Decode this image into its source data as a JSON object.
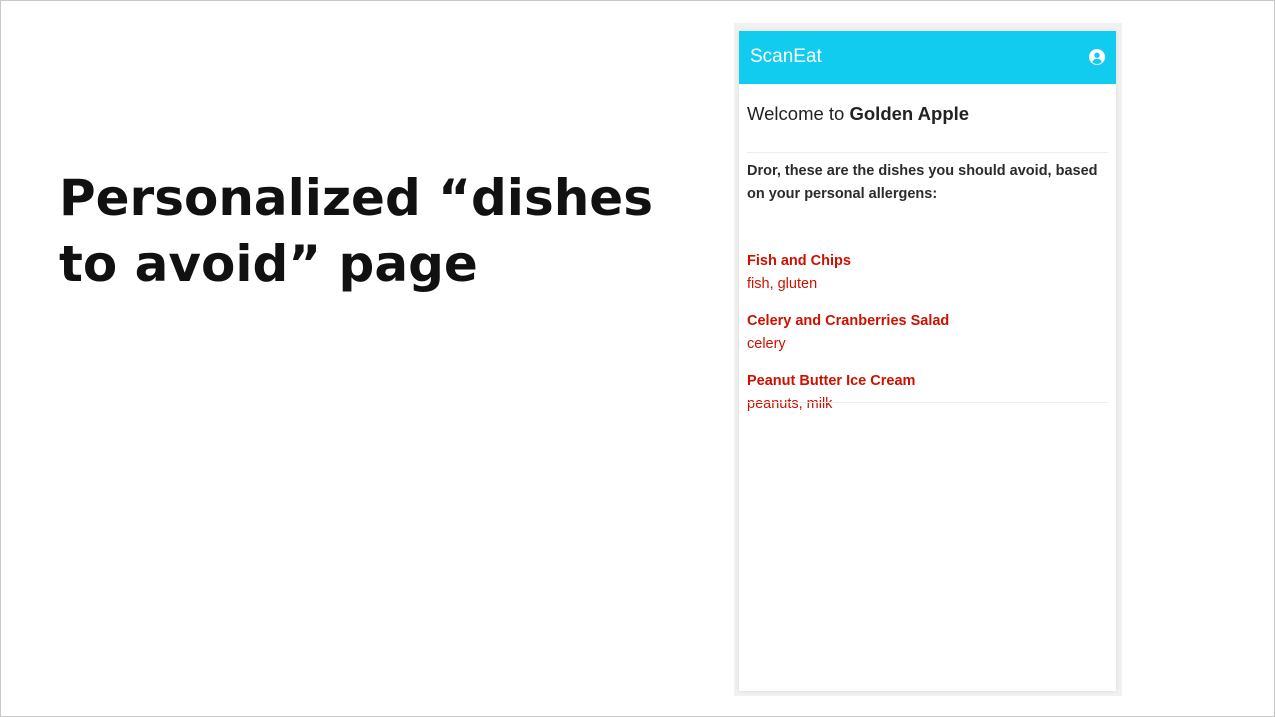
{
  "slide": {
    "title": "Personalized “dishes to avoid” page"
  },
  "app": {
    "name": "ScanEat",
    "account_icon": "user-circle-icon",
    "colors": {
      "app_bar": "#12ccf0",
      "warning_text": "#cc1100"
    },
    "welcome_prefix": "Welcome to ",
    "restaurant_name": "Golden Apple",
    "intro": "Dror, these are the dishes you should avoid, based on your personal allergens:",
    "dishes": [
      {
        "name": "Fish and Chips",
        "allergens": "fish, gluten"
      },
      {
        "name": "Celery and Cranberries Salad",
        "allergens": "celery"
      },
      {
        "name": "Peanut Butter Ice Cream",
        "allergens": "peanuts, milk"
      }
    ]
  }
}
